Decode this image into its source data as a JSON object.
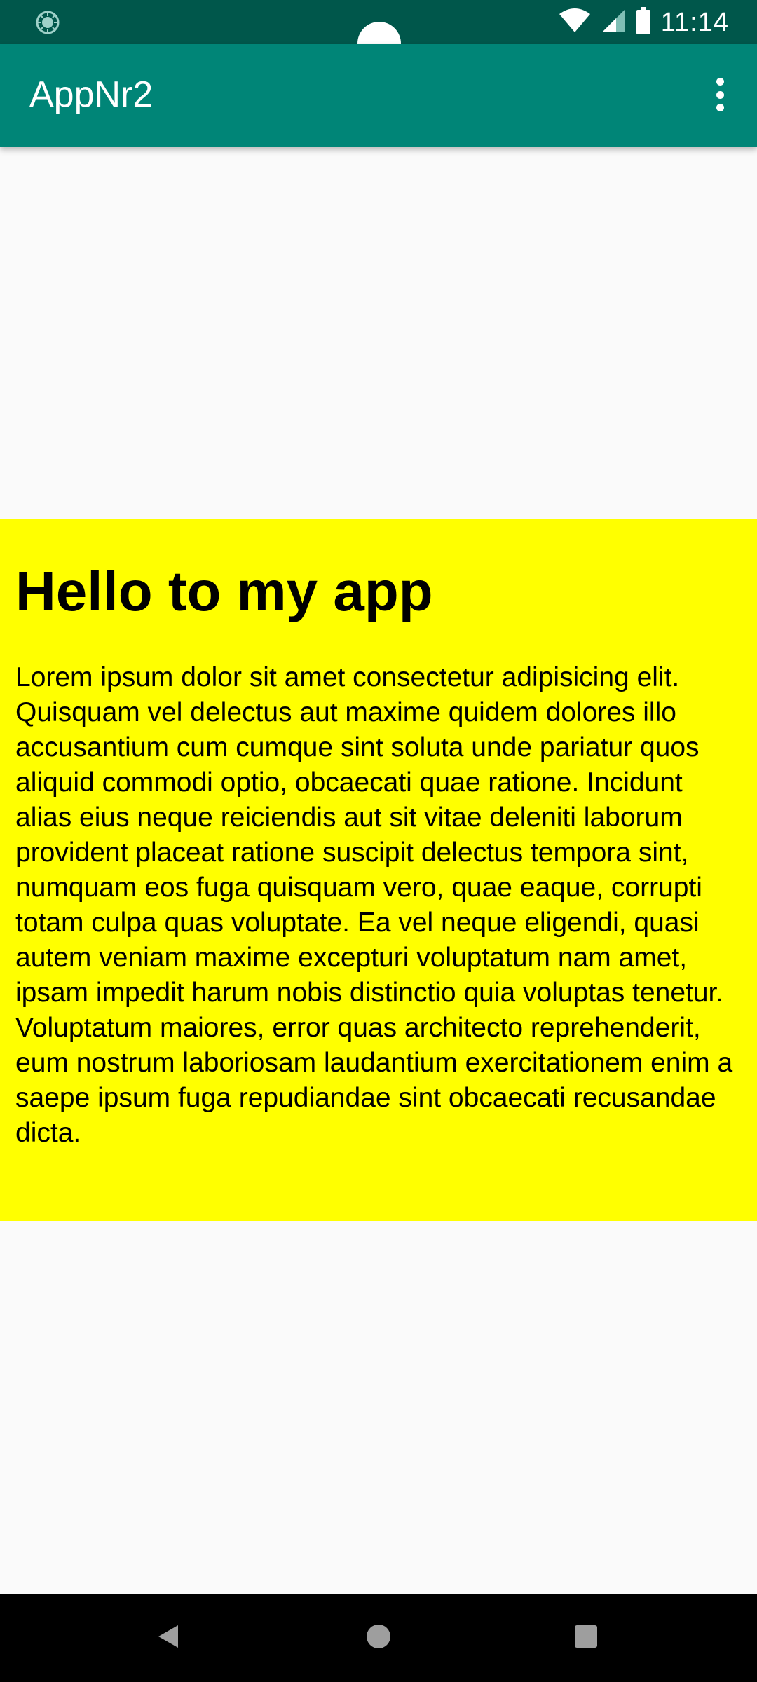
{
  "status_bar": {
    "time": "11:14",
    "left_icon": "sync-icon",
    "icons": [
      "wifi-icon",
      "signal-icon",
      "battery-icon"
    ],
    "background": "#00574b"
  },
  "app_bar": {
    "title": "AppNr2",
    "menu_icon": "overflow-menu-icon",
    "background": "#008577"
  },
  "content": {
    "title": "Hello to my app",
    "body": "Lorem ipsum dolor sit amet consectetur adipisicing elit. Quisquam vel delectus aut maxime quidem dolores illo accusantium cum cumque sint soluta unde pariatur quos aliquid commodi optio, obcaecati quae ratione. Incidunt alias eius neque reiciendis aut sit vitae deleniti laborum provident placeat ratione suscipit delectus tempora sint, numquam eos fuga quisquam vero, quae eaque, corrupti totam culpa quas voluptate. Ea vel neque eligendi, quasi autem veniam maxime excepturi voluptatum nam amet, ipsam impedit harum nobis distinctio quia voluptas tenetur. Voluptatum maiores, error quas architecto reprehenderit, eum nostrum laboriosam laudantium exercitationem enim a saepe ipsum fuga repudiandae sint obcaecati recusandae dicta.",
    "background": "#ffff00"
  },
  "nav_bar": {
    "buttons": [
      "back-icon",
      "home-icon",
      "recents-icon"
    ]
  }
}
